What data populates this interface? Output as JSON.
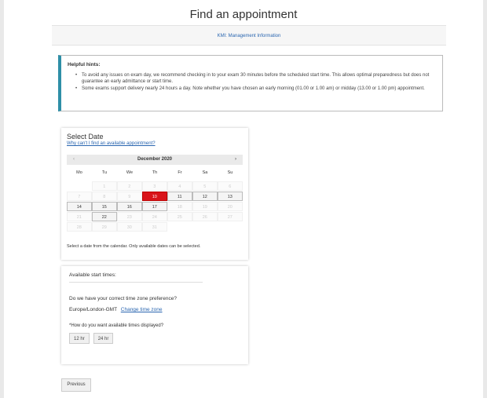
{
  "page": {
    "title": "Find an appointment",
    "subheader": "KMI: Management Information"
  },
  "hints": {
    "heading": "Helpful hints:",
    "items": [
      "To avoid any issues on exam day, we recommend checking in to your exam 30 minutes before the scheduled start time. This allows optimal preparedness but does not guarantee an early admittance or start time.",
      "Some exams support delivery nearly 24 hours a day. Note whether you have chosen an early morning (01.00 or 1.00 am) or midday (13.00 or 1.00 pm) appointment."
    ]
  },
  "date_select": {
    "heading": "Select Date",
    "help_link": "Why can't I find an available appointment?",
    "month": "December 2020",
    "prev_icon": "‹",
    "next_icon": "›",
    "weekdays": [
      "Mo",
      "Tu",
      "We",
      "Th",
      "Fr",
      "Sa",
      "Su"
    ],
    "weeks": [
      [
        {
          "d": ""
        },
        {
          "d": "1"
        },
        {
          "d": "2"
        },
        {
          "d": "3"
        },
        {
          "d": "4"
        },
        {
          "d": "5"
        },
        {
          "d": "6"
        }
      ],
      [
        {
          "d": "7"
        },
        {
          "d": "8"
        },
        {
          "d": "9"
        },
        {
          "d": "10",
          "s": "sel"
        },
        {
          "d": "11",
          "s": "avail"
        },
        {
          "d": "12",
          "s": "avail"
        },
        {
          "d": "13",
          "s": "avail"
        }
      ],
      [
        {
          "d": "14",
          "s": "avail"
        },
        {
          "d": "15",
          "s": "avail"
        },
        {
          "d": "16",
          "s": "avail"
        },
        {
          "d": "17",
          "s": "avail"
        },
        {
          "d": "18"
        },
        {
          "d": "19"
        },
        {
          "d": "20"
        }
      ],
      [
        {
          "d": "21"
        },
        {
          "d": "22",
          "s": "avail"
        },
        {
          "d": "23"
        },
        {
          "d": "24"
        },
        {
          "d": "25"
        },
        {
          "d": "26"
        },
        {
          "d": "27"
        }
      ],
      [
        {
          "d": "28"
        },
        {
          "d": "29"
        },
        {
          "d": "30"
        },
        {
          "d": "31"
        },
        {
          "d": ""
        },
        {
          "d": ""
        },
        {
          "d": ""
        }
      ]
    ],
    "note": "Select a date from the calendar. Only available dates can be selected."
  },
  "times": {
    "heading": "Available start times:",
    "tz_question": "Do we have your correct time zone preference?",
    "tz_value": "Europe/London-GMT",
    "tz_link": "Change time zone",
    "format_question": "*How do you want available times displayed?",
    "btn_12": "12 hr",
    "btn_24": "24 hr"
  },
  "nav": {
    "previous": "Previous"
  },
  "colors": {
    "selected_day": "#d9141b",
    "accent": "#2e8fa7",
    "link": "#2a66b0"
  }
}
